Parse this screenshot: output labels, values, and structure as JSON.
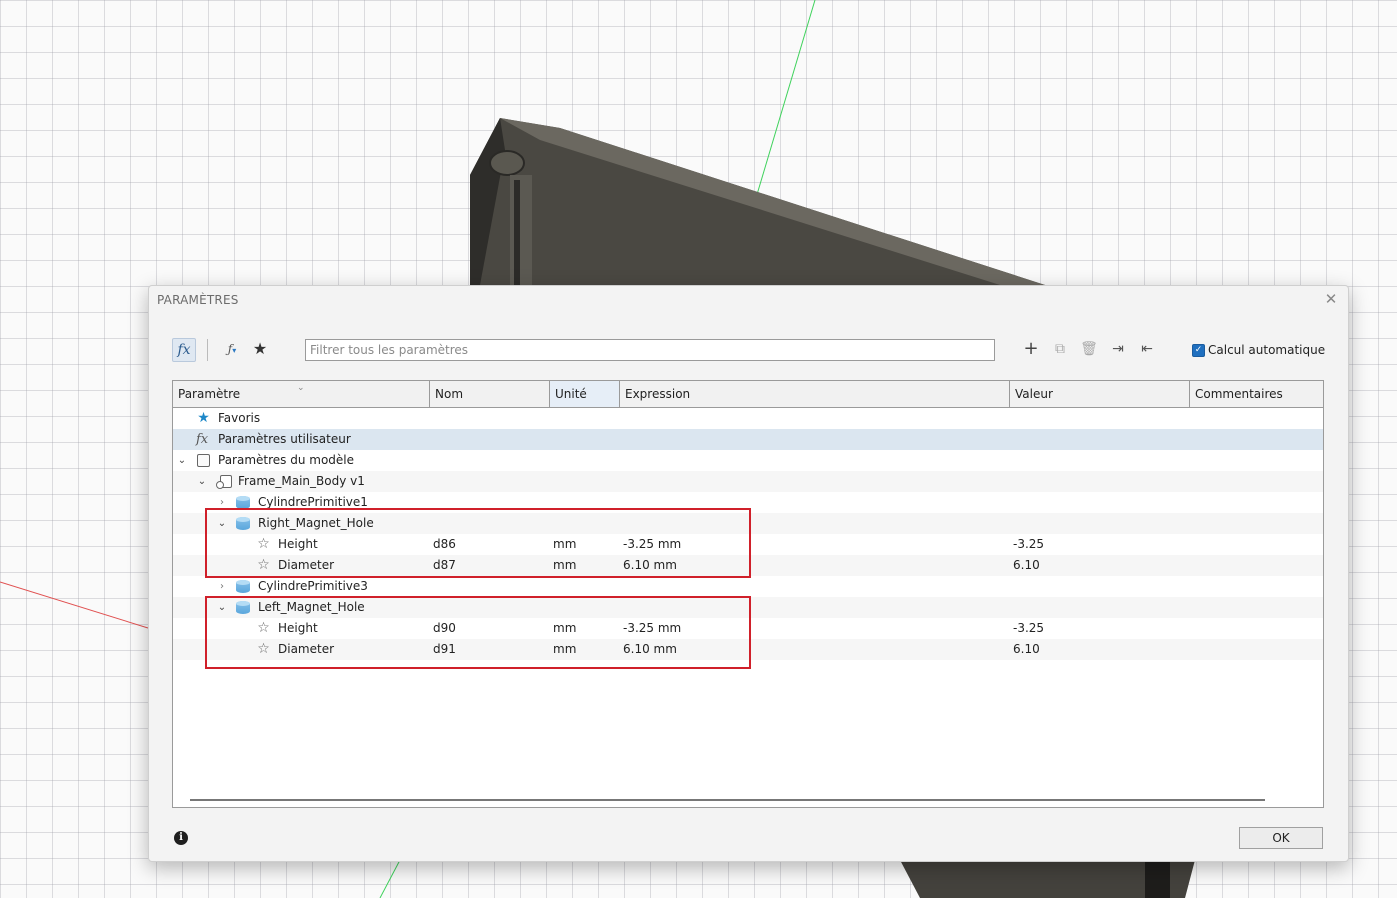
{
  "dialog": {
    "title": "PARAMÈTRES",
    "close_icon": "close-icon",
    "ok_label": "OK"
  },
  "toolbar": {
    "fx_icon": "fx",
    "filter_icon": "fx-filter-icon",
    "favorites_icon": "star-icon",
    "search_placeholder": "Filtrer tous les paramètres",
    "actions": [
      "add-icon",
      "copy-icon",
      "delete-icon",
      "import-icon",
      "export-icon"
    ],
    "auto_calc_label": "Calcul automatique",
    "auto_calc_checked": true
  },
  "columns": {
    "parametre": "Paramètre",
    "nom": "Nom",
    "unite": "Unité",
    "expression": "Expression",
    "valeur": "Valeur",
    "commentaires": "Commentaires"
  },
  "tree": {
    "favoris": "Favoris",
    "user_params": "Paramètres utilisateur",
    "fx_glyph": "fx",
    "model_params": "Paramètres du modèle",
    "component": "Frame_Main_Body v1",
    "feature1": "CylindrePrimitive1",
    "right": {
      "label": "Right_Magnet_Hole",
      "height": {
        "label": "Height",
        "name": "d86",
        "unit": "mm",
        "expression": "-3.25 mm",
        "value": "-3.25"
      },
      "diameter": {
        "label": "Diameter",
        "name": "d87",
        "unit": "mm",
        "expression": "6.10 mm",
        "value": "6.10"
      }
    },
    "feature3": "CylindrePrimitive3",
    "left": {
      "label": "Left_Magnet_Hole",
      "height": {
        "label": "Height",
        "name": "d90",
        "unit": "mm",
        "expression": "-3.25 mm",
        "value": "-3.25"
      },
      "diameter": {
        "label": "Diameter",
        "name": "d91",
        "unit": "mm",
        "expression": "6.10 mm",
        "value": "6.10"
      }
    }
  },
  "colors": {
    "accent": "#1f6fbf",
    "highlight_box": "#d0202a",
    "selected_row": "#dbe6f0",
    "model_body": "#4a4842"
  }
}
